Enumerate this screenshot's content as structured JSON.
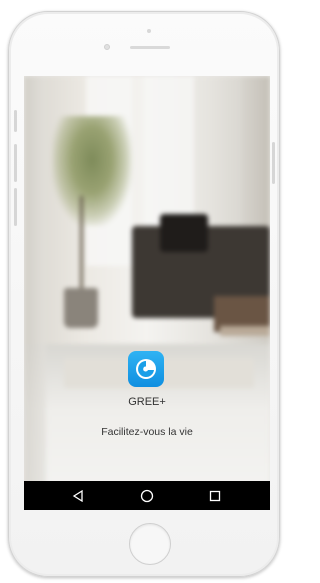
{
  "app": {
    "name": "GREE+",
    "tagline": "Facilitez-vous la vie",
    "icon": "gree-logo-icon",
    "icon_color": "#1a9fe8"
  },
  "navbar": {
    "back_icon": "back-triangle-icon",
    "home_icon": "home-circle-icon",
    "recent_icon": "recent-apps-square-icon",
    "background": "#000000"
  },
  "device": {
    "home_button_icon": "hardware-home-button-icon"
  }
}
